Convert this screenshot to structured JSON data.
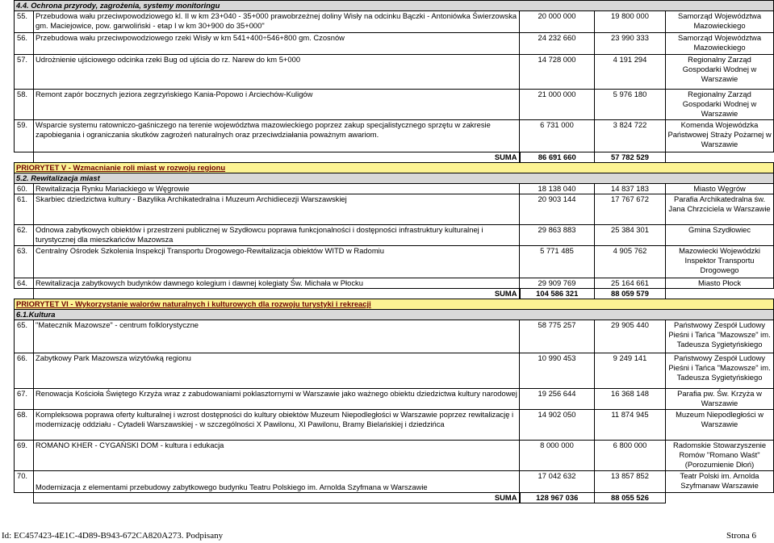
{
  "section_44": "4.4. Ochrona przyrody, zagrożenia, systemy monitoringu",
  "rows_a": [
    {
      "num": "55.",
      "desc": "Przebudowa wału przeciwpowodziowego kl. II w km 23+040 - 35+000 prawobrzeżnej doliny Wisły na odcinku Bączki - Antoniówka Świerzowska gm. Maciejowice, pow. garwoliński - etap I w km 30+900 do 35+000\"",
      "v1": "20 000 000",
      "v2": "19 800 000",
      "inst": "Samorząd Województwa Mazowieckiego"
    },
    {
      "num": "56.",
      "desc": "Przebudowa wału przeciwpowodziowego rzeki Wisły w km 541+400÷546+800 gm. Czosnów",
      "v1": "24 232 660",
      "v2": "23 990 333",
      "inst": "Samorząd Województwa Mazowieckiego"
    },
    {
      "num": "57.",
      "desc": "Udrożnienie ujściowego odcinka rzeki Bug od ujścia do rz. Narew do km 5+000",
      "v1": "14 728 000",
      "v2": "4 191 294",
      "inst": "Regionalny Zarząd Gospodarki Wodnej w Warszawie"
    },
    {
      "num": "58.",
      "desc": "Remont zapór bocznych jeziora zegrzyńskiego Kania-Popowo i Arciechów-Kuligów",
      "v1": "21 000 000",
      "v2": "5 976 180",
      "inst": "Regionalny Zarząd Gospodarki Wodnej w Warszawie"
    },
    {
      "num": "59.",
      "desc": "Wsparcie systemu ratowniczo-gaśniczego na terenie województwa mazowieckiego poprzez zakup specjalistycznego sprzętu w zakresie zapobiegania i ograniczania skutków zagrożeń naturalnych oraz przeciwdziałania poważnym awariom.",
      "v1": "6 731 000",
      "v2": "3 824 722",
      "inst": "Komenda Wojewódzka Państwowej Straży Pożarnej w Warszawie"
    }
  ],
  "suma_a": {
    "label": "SUMA",
    "v1": "86 691 660",
    "v2": "57 782 529"
  },
  "priority_v": "PRIORYTET V - Wzmacnianie roli miast w rozwoju regionu",
  "section_52": "5.2. Rewitalizacja miast",
  "rows_b": [
    {
      "num": "60.",
      "desc": "Rewitalizacja Rynku Mariackiego w Węgrowie",
      "v1": "18 138 040",
      "v2": "14 837 183",
      "inst": "Miasto Węgrów"
    },
    {
      "num": "61.",
      "desc": "Skarbiec dziedzictwa kultury - Bazylika Archikatedralna i Muzeum Archidiecezji Warszawskiej",
      "v1": "20 903 144",
      "v2": "17 767 672",
      "inst": "Parafia Archikatedralna św. Jana Chrzciciela w Warszawie"
    },
    {
      "num": "62.",
      "desc": "Odnowa zabytkowych obiektów i przestrzeni publicznej w Szydłowcu poprawa funkcjonalności i dostępności infrastruktury kulturalnej i turystycznej dla mieszkańców Mazowsza",
      "v1": "29 863 883",
      "v2": "25 384 301",
      "inst": "Gmina Szydłowiec"
    },
    {
      "num": "63.",
      "desc": "Centralny Ośrodek Szkolenia Inspekcji Transportu Drogowego-Rewitalizacja obiektów WITD w Radomiu",
      "v1": "5 771 485",
      "v2": "4 905 762",
      "inst": "Mazowiecki Wojewódzki Inspektor Transportu Drogowego"
    },
    {
      "num": "64.",
      "desc": "Rewitalizacja zabytkowych budynków dawnego kolegium i dawnej kolegiaty Św. Michała w Płocku",
      "v1": "29 909 769",
      "v2": "25 164 661",
      "inst": "Miasto Płock"
    }
  ],
  "suma_b": {
    "label": "SUMA",
    "v1": "104 586 321",
    "v2": "88 059 579"
  },
  "priority_vi": "PRIORYTET VI - Wykorzystanie walorów naturalnych i kulturowych dla rozwoju turystyki i rekreacji",
  "section_61": "6.1.Kultura",
  "rows_c": [
    {
      "num": "65.",
      "desc": "\"Matecznik Mazowsze\" - centrum folklorystyczne",
      "v1": "58 775 257",
      "v2": "29 905 440",
      "inst": "Państwowy Zespół Ludowy Pieśni i Tańca \"Mazowsze\" im. Tadeusza Sygietyńskiego"
    },
    {
      "num": "66.",
      "desc": "Zabytkowy Park Mazowsza wizytówką regionu",
      "v1": "10 990 453",
      "v2": "9 249 141",
      "inst": "Państwowy Zespół Ludowy Pieśni i Tańca \"Mazowsze\" im. Tadeusza Sygietyńskiego"
    },
    {
      "num": "67.",
      "desc": "Renowacja Kościoła Świętego Krzyża wraz z zabudowaniami poklasztornymi w Warszawie jako ważnego obiektu dziedzictwa kultury narodowej",
      "v1": "19 256 644",
      "v2": "16 368 148",
      "inst": "Parafia pw. Św. Krzyża w Warszawie"
    },
    {
      "num": "68.",
      "desc": "Kompleksowa poprawa oferty kulturalnej i wzrost dostępności do kultury obiektów Muzeum Niepodległości w Warszawie poprzez rewitalizację i modernizację oddziału - Cytadeli Warszawskiej - w szczególności X Pawilonu, XI Pawilonu, Bramy Bielańskiej i dziedzińca",
      "v1": "14 902 050",
      "v2": "11 874 945",
      "inst": "Muzeum Niepodległości w Warszawie"
    },
    {
      "num": "69.",
      "desc": "ROMANO KHER - CYGAŃSKI DOM - kultura i edukacja",
      "v1": "8 000 000",
      "v2": "6 800 000",
      "inst": "Radomskie Stowarzyszenie Romów \"Romano Waśt\" (Porozumienie Dłoń)"
    },
    {
      "num": "70.",
      "desc": "Modernizacja z elementami przebudowy zabytkowego budynku Teatru Polskiego im. Arnolda Szyfmana w Warszawie",
      "v1": "17 042 632",
      "v2": "13 857 852",
      "inst": "Teatr Polski im. Arnolda Szyfmanaw Warszawie"
    }
  ],
  "suma_c": {
    "label": "SUMA",
    "v1": "128 967 036",
    "v2": "88 055 526"
  },
  "footer": {
    "id": "Id: EC457423-4E1C-4D89-B943-672CA820A273. Podpisany",
    "page": "Strona 6"
  }
}
